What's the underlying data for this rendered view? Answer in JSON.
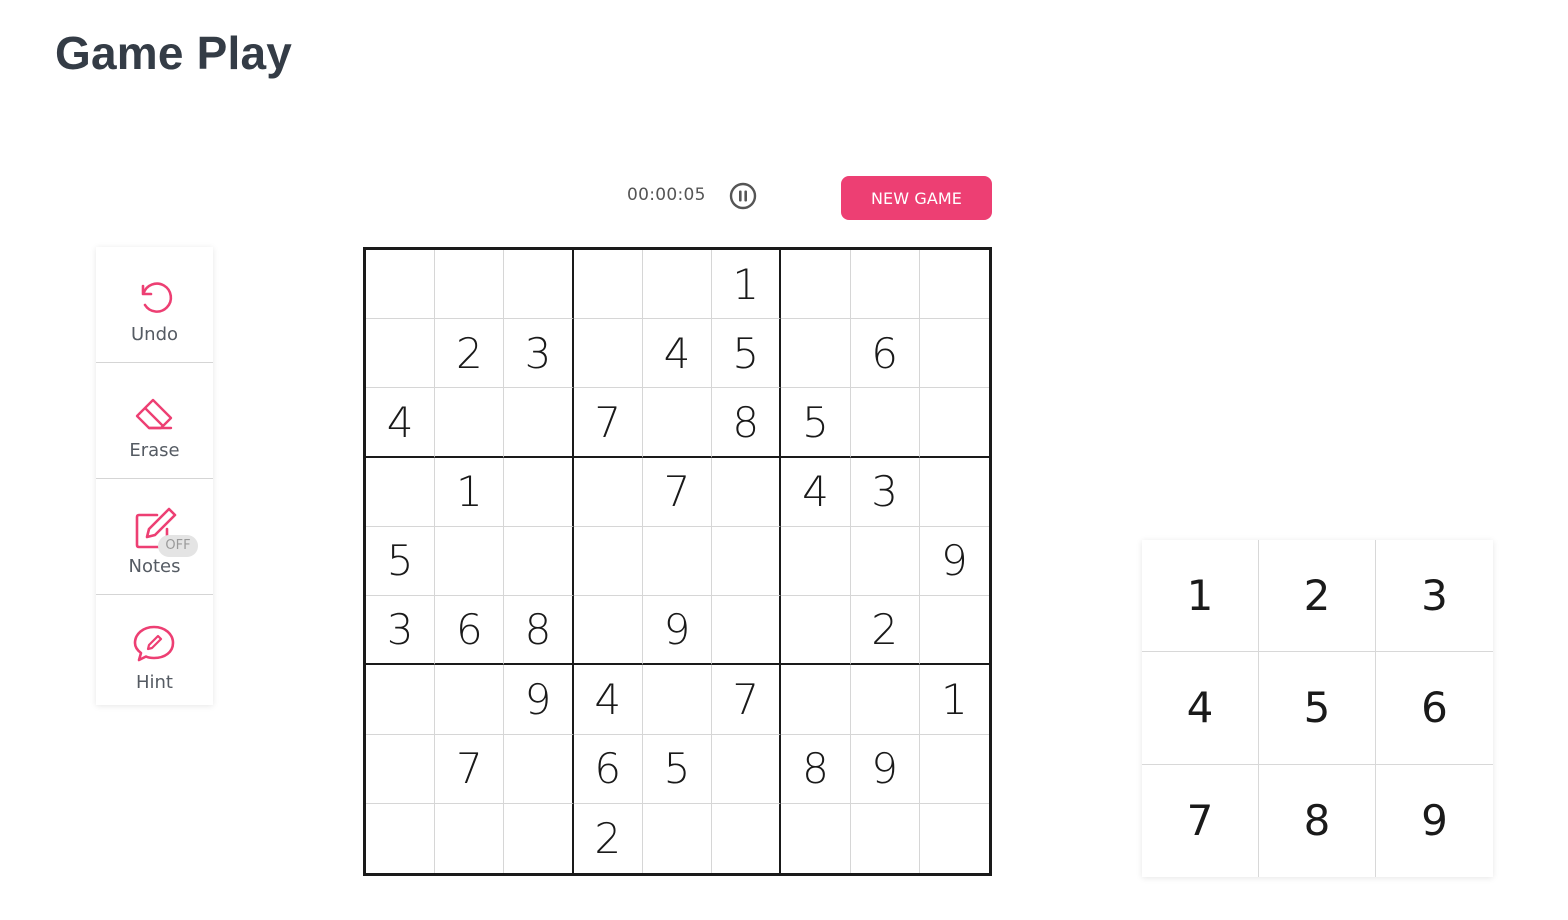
{
  "page": {
    "title": "Game Play"
  },
  "header": {
    "timer": "00:00:05",
    "pause_icon": "pause-circle-icon",
    "new_game_label": "NEW GAME"
  },
  "toolbar": {
    "items": [
      {
        "label": "Undo",
        "icon": "undo-icon"
      },
      {
        "label": "Erase",
        "icon": "eraser-icon"
      },
      {
        "label": "Notes",
        "icon": "pencil-note-icon",
        "badge": "OFF"
      },
      {
        "label": "Hint",
        "icon": "hint-icon"
      }
    ]
  },
  "board": {
    "cells": [
      [
        "",
        "",
        "",
        "",
        "",
        "1",
        "",
        "",
        ""
      ],
      [
        "",
        "2",
        "3",
        "",
        "4",
        "5",
        "",
        "6",
        ""
      ],
      [
        "4",
        "",
        "",
        "7",
        "",
        "8",
        "5",
        "",
        ""
      ],
      [
        "",
        "1",
        "",
        "",
        "7",
        "",
        "4",
        "3",
        ""
      ],
      [
        "5",
        "",
        "",
        "",
        "",
        "",
        "",
        "",
        "9"
      ],
      [
        "3",
        "6",
        "8",
        "",
        "9",
        "",
        "",
        "2",
        ""
      ],
      [
        "",
        "",
        "9",
        "4",
        "",
        "7",
        "",
        "",
        "1"
      ],
      [
        "",
        "7",
        "",
        "6",
        "5",
        "",
        "8",
        "9",
        ""
      ],
      [
        "",
        "",
        "",
        "2",
        "",
        "",
        "",
        "",
        ""
      ]
    ]
  },
  "numpad": {
    "keys": [
      "1",
      "2",
      "3",
      "4",
      "5",
      "6",
      "7",
      "8",
      "9"
    ]
  },
  "colors": {
    "accent": "#ed3f73",
    "title": "#343c46",
    "grid_major": "#1a1a1a",
    "grid_minor": "#d6d6d6"
  }
}
